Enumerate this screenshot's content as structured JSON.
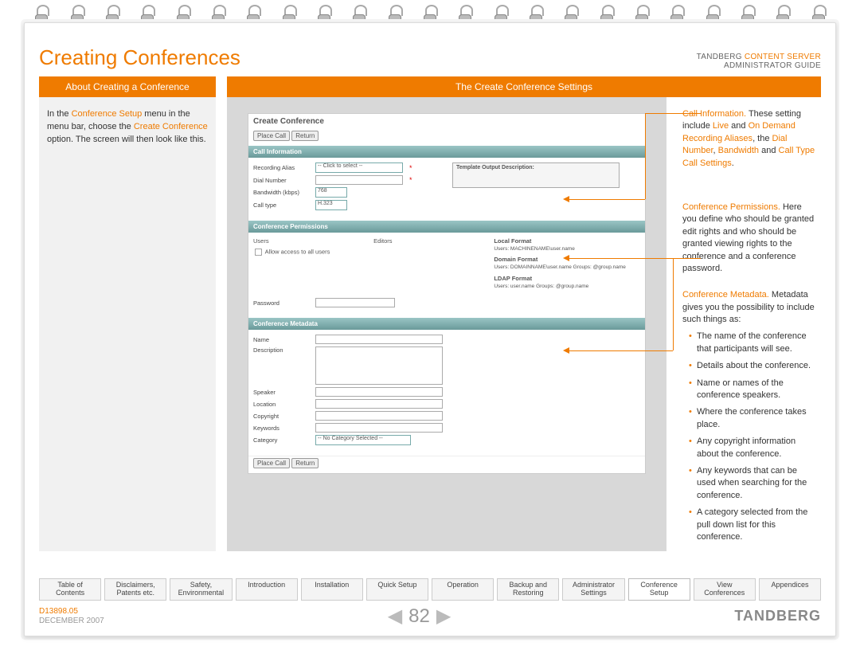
{
  "header": {
    "title": "Creating Conferences",
    "product_prefix": "TANDBERG ",
    "product_orange": "CONTENT SERVER",
    "guide": "ADMINISTRATOR GUIDE"
  },
  "tabs": {
    "left": "About Creating a Conference",
    "right": "The Create Conference Settings"
  },
  "left_col": {
    "p1a": "In the ",
    "p1b": "Conference Setup",
    "p1c": " menu in the menu bar, choose the ",
    "p1d": "Create Conference",
    "p1e": " option. The screen will then look like this."
  },
  "shot": {
    "title": "Create Conference",
    "btn_place": "Place Call",
    "btn_return": "Return",
    "sec1": "Call Information",
    "sec2": "Conference Permissions",
    "sec3": "Conference Metadata",
    "rec_alias": "Recording Alias",
    "rec_alias_val": "-- Click to select --",
    "dial": "Dial Number",
    "bw": "Bandwidth (kbps)",
    "bw_val": "768",
    "calltype": "Call type",
    "calltype_val": "H.323",
    "tpl": "Template Output Description:",
    "users": "Users",
    "editors": "Editors",
    "allow": "Allow access to all users",
    "local_fmt": "Local Format",
    "local_fmt_d": "Users: MACHINENAME\\user.name",
    "domain_fmt": "Domain Format",
    "domain_fmt_d": "Users: DOMAINNAME\\user.name  Groups: @group.name",
    "ldap_fmt": "LDAP Format",
    "ldap_fmt_d": "Users: user.name  Groups: @group.name",
    "password": "Password",
    "name": "Name",
    "description": "Description",
    "speaker": "Speaker",
    "location": "Location",
    "copyright": "Copyright",
    "keywords": "Keywords",
    "category": "Category",
    "category_val": "-- No Category Selected --"
  },
  "right_col": {
    "r1a": "Call Information.",
    "r1b": " These setting include ",
    "r1c": "Live",
    "r1d": " and ",
    "r1e": "On Demand Recording Aliases",
    "r1f": ", the ",
    "r1g": "Dial Number",
    "r1h": ", ",
    "r1i": "Bandwidth",
    "r1j": " and ",
    "r1k": "Call Type Call Settings",
    "r1l": ".",
    "r2a": "Conference Permissions.",
    "r2b": " Here you define who should be granted edit rights and who should be granted viewing rights to the conference and a conference password.",
    "r3a": "Conference Metadata.",
    "r3b": " Metadata gives you the possibility to include such things as:",
    "li1": "The name of the conference that participants will see.",
    "li2": "Details about the conference.",
    "li3": "Name or names of the conference speakers.",
    "li4": "Where the conference takes place.",
    "li5": "Any copyright information about the conference.",
    "li6": "Any keywords that can be used when searching for the conference.",
    "li7": "A category selected from the pull down list for this conference."
  },
  "nav": [
    {
      "l1": "Table of",
      "l2": "Contents"
    },
    {
      "l1": "Disclaimers,",
      "l2": "Patents etc."
    },
    {
      "l1": "Safety,",
      "l2": "Environmental"
    },
    {
      "l1": "Introduction",
      "l2": ""
    },
    {
      "l1": "Installation",
      "l2": ""
    },
    {
      "l1": "Quick Setup",
      "l2": ""
    },
    {
      "l1": "Operation",
      "l2": ""
    },
    {
      "l1": "Backup and",
      "l2": "Restoring"
    },
    {
      "l1": "Administrator",
      "l2": "Settings"
    },
    {
      "l1": "Conference",
      "l2": "Setup"
    },
    {
      "l1": "View",
      "l2": "Conferences"
    },
    {
      "l1": "Appendices",
      "l2": ""
    }
  ],
  "footer": {
    "doc": "D13898.05",
    "date": "DECEMBER 2007",
    "page": "82",
    "brand": "TANDBERG"
  }
}
